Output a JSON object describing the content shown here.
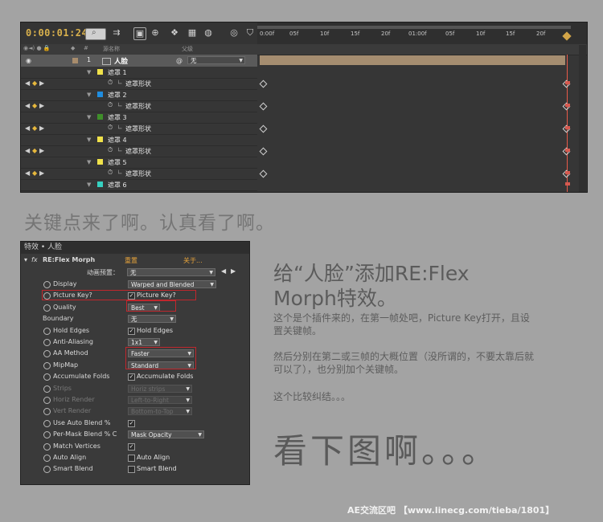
{
  "timeline": {
    "timecode": "0:00:01:24",
    "header": {
      "source_name": "源名称",
      "parent": "父级"
    },
    "ruler_ticks": [
      "0:00f",
      "05f",
      "10f",
      "15f",
      "20f",
      "01:00f",
      "05f",
      "10f",
      "15f",
      "20f"
    ],
    "layer": {
      "number": "1",
      "name": "人脸",
      "parent_value": "无"
    },
    "rows": [
      {
        "name": "遮罩 1",
        "color": "#f0e24a",
        "sub": "遮罩形状"
      },
      {
        "name": "遮罩 2",
        "color": "#1f8de0",
        "sub": "遮罩形状"
      },
      {
        "name": "遮罩 3",
        "color": "#3f8f2a",
        "sub": "遮罩形状"
      },
      {
        "name": "遮罩 4",
        "color": "#f0e24a",
        "sub": "遮罩形状"
      },
      {
        "name": "遮罩 5",
        "color": "#f0e24a",
        "sub": "遮罩形状"
      },
      {
        "name": "遮罩 6",
        "color": "#36d0c0",
        "sub": ""
      }
    ]
  },
  "headline": "关键点来了啊。认真看了啊。",
  "effects": {
    "title": "特效 • 人脸",
    "effect_name": "RE:Flex Morph",
    "reset": "重置",
    "about": "关于...",
    "preset_label": "动画预置：",
    "preset_value": "无",
    "params": [
      {
        "label": "Display",
        "control": "dropdown",
        "value": "Warped and Blended"
      },
      {
        "label": "Picture Key?",
        "control": "checkbox",
        "checked": true,
        "value": "Picture Key?"
      },
      {
        "label": "Quality",
        "control": "dropdown",
        "value": "Best"
      },
      {
        "label": "Boundary",
        "control": "dropdown",
        "value": "无"
      },
      {
        "label": "Hold Edges",
        "control": "checkbox",
        "checked": true,
        "value": "Hold Edges"
      },
      {
        "label": "Anti-Aliasing",
        "control": "dropdown",
        "value": "1x1"
      },
      {
        "label": "AA Method",
        "control": "dropdown",
        "value": "Faster"
      },
      {
        "label": "MipMap",
        "control": "dropdown",
        "value": "Standard"
      },
      {
        "label": "Accumulate Folds",
        "control": "checkbox",
        "checked": true,
        "value": "Accumulate Folds"
      },
      {
        "label": "Strips",
        "control": "dropdown",
        "value": "Horiz strips",
        "disabled": true
      },
      {
        "label": "Horiz Render",
        "control": "dropdown",
        "value": "Left-to-Right",
        "disabled": true
      },
      {
        "label": "Vert Render",
        "control": "dropdown",
        "value": "Bottom-to-Top",
        "disabled": true
      },
      {
        "label": "Use Auto Blend %",
        "control": "checkbox",
        "checked": true,
        "value": ""
      },
      {
        "label": "Per-Mask Blend % C",
        "control": "dropdown",
        "value": "Mask Opacity"
      },
      {
        "label": "Match Vertices",
        "control": "checkbox",
        "checked": true,
        "value": ""
      },
      {
        "label": "Auto Align",
        "control": "checkbox",
        "checked": false,
        "value": "Auto Align"
      },
      {
        "label": "Smart Blend",
        "control": "checkbox",
        "checked": false,
        "value": "Smart Blend"
      }
    ]
  },
  "right": {
    "title": "给“人脸”添加RE:Flex Morph特效。",
    "p1": "这个是个插件来的，在第一帧处吧，Picture Key打开，且设置关键帧。",
    "p2": "然后分别在第二或三帧的大概位置（没所谓的，不要太靠后就可以了），也分别加个关键帧。",
    "p3": "这个比较纠结。。。",
    "big": "看下图啊。。。"
  },
  "footer": "AE交流区吧 【www.linecg.com/tieba/1801】",
  "colors": {
    "background": "#a3a3a3",
    "highlight": "#c0272d",
    "timecode": "#d8b04c"
  }
}
